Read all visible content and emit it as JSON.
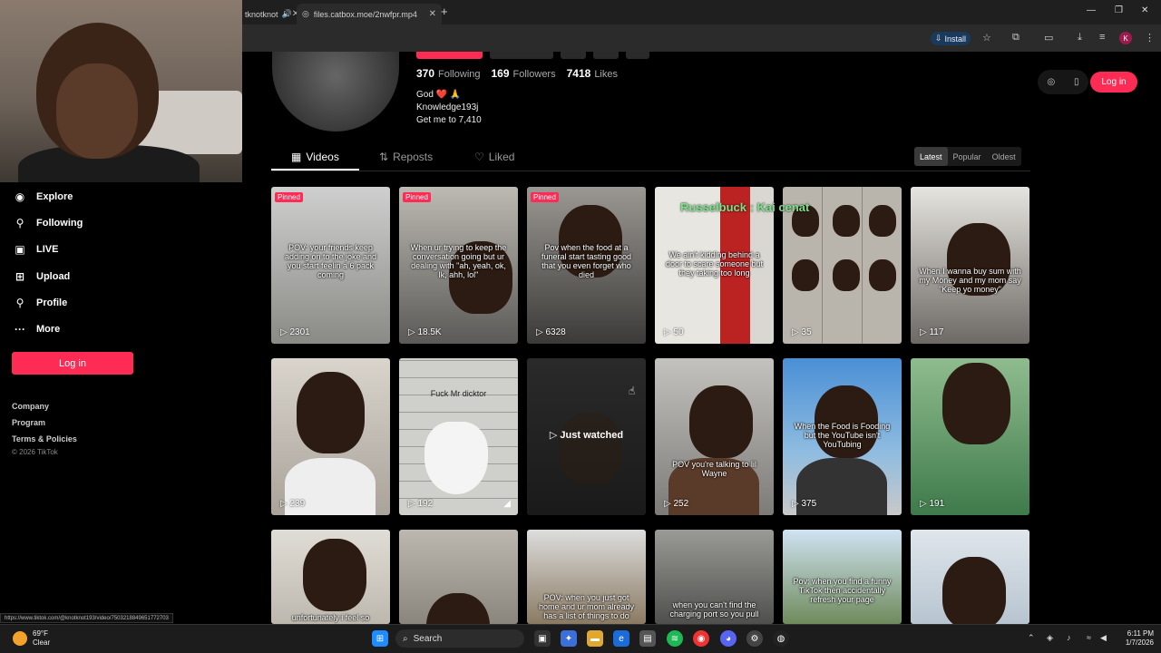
{
  "browser": {
    "tab1_title": "tknotknot",
    "tab2_title": "files.catbox.moe/2nwfpr.mp4",
    "install_label": "Install",
    "profile_initial": "K"
  },
  "sidebar": {
    "items": [
      {
        "label": "Explore",
        "icon": "compass-icon"
      },
      {
        "label": "Following",
        "icon": "person-icon"
      },
      {
        "label": "LIVE",
        "icon": "live-icon"
      },
      {
        "label": "Upload",
        "icon": "plus-square-icon"
      },
      {
        "label": "Profile",
        "icon": "person-icon"
      },
      {
        "label": "More",
        "icon": "more-dots-icon"
      }
    ],
    "login_label": "Log in",
    "footer_links": [
      "Company",
      "Program",
      "Terms & Policies"
    ],
    "copyright": "© 2026 TikTok"
  },
  "profile": {
    "following_count": "370",
    "following_label": "Following",
    "followers_count": "169",
    "followers_label": "Followers",
    "likes_count": "7418",
    "likes_label": "Likes",
    "bio_line1": "God ❤️ 🙏",
    "bio_line2": "Knowledge193j",
    "bio_line3": "Get me to 7,410"
  },
  "tabs": {
    "videos": "Videos",
    "reposts": "Reposts",
    "liked": "Liked"
  },
  "sort": {
    "latest": "Latest",
    "popular": "Popular",
    "oldest": "Oldest"
  },
  "header_right": {
    "login_label": "Log in"
  },
  "overlay_text": "Russelbuck : Kai cenat",
  "videos": [
    {
      "pinned": "Pinned",
      "caption": "POV: your friends keep adding on to the joke and you start feelin a 6 pack coming",
      "views": "2301"
    },
    {
      "pinned": "Pinned",
      "caption": "When ur trying to keep the conversation going but ur dealing with \"ah, yeah, ok, lk, ahh, lol\"",
      "views": "18.5K"
    },
    {
      "pinned": "Pinned",
      "caption": "Pov when the food at a funeral start tasting good that you even forget who died",
      "views": "6328"
    },
    {
      "pinned": "",
      "caption": "We ain't kidding behind a door to scare someone but they taking too long",
      "views": "50"
    },
    {
      "pinned": "",
      "caption": "",
      "views": "35"
    },
    {
      "pinned": "",
      "caption": "When I wanna buy sum with my Money and my mom say \"Keep yo money\"",
      "views": "117"
    },
    {
      "pinned": "",
      "caption": "",
      "views": "239"
    },
    {
      "pinned": "",
      "caption": "Fuck Mr dicktor",
      "views": "192"
    },
    {
      "pinned": "",
      "caption": "",
      "views": "",
      "just_watched": "Just watched"
    },
    {
      "pinned": "",
      "caption": "POV you're talking to lil Wayne",
      "views": "252"
    },
    {
      "pinned": "",
      "caption": "When the Food is Fooding but the YouTube isn't YouTubing",
      "views": "375"
    },
    {
      "pinned": "",
      "caption": "",
      "views": "191"
    },
    {
      "pinned": "",
      "caption": "unfortunately i feel so",
      "views": ""
    },
    {
      "pinned": "",
      "caption": "",
      "views": ""
    },
    {
      "pinned": "",
      "caption": "POV: when you just got home and ur mom already has a list of things to do",
      "views": ""
    },
    {
      "pinned": "",
      "caption": "when you can't find the charging port so you pull",
      "views": ""
    },
    {
      "pinned": "",
      "caption": "Pov: when you find a funny TikTok then accidentally refresh your page",
      "views": ""
    },
    {
      "pinned": "",
      "caption": "",
      "views": ""
    }
  ],
  "status_url": "https://www.tiktok.com/@knotknot193/video/7503218849651772703",
  "taskbar": {
    "temp": "69°F",
    "condition": "Clear",
    "search_label": "Search",
    "time": "6:11 PM",
    "date": "1/7/2026"
  },
  "colors": {
    "accent": "#fe2c55",
    "background": "#000000"
  }
}
